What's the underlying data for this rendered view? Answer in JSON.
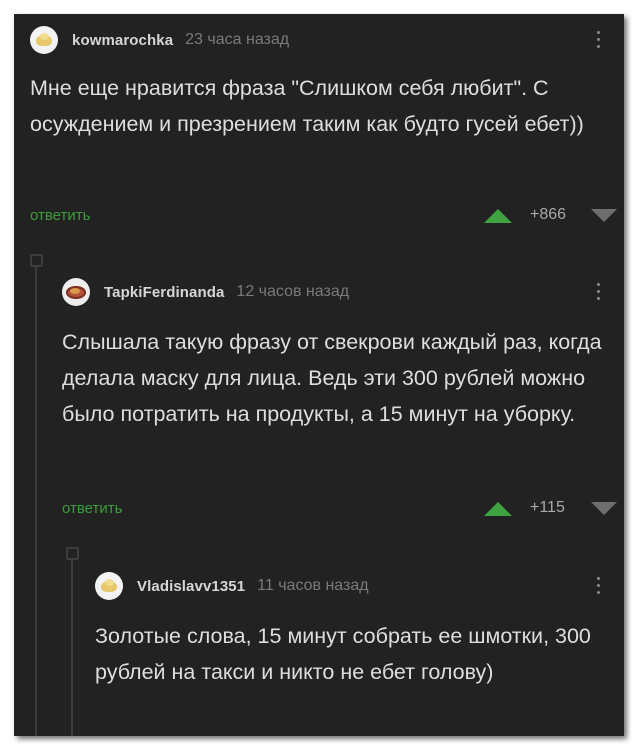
{
  "comments": [
    {
      "username": "kowmarochka",
      "time": "23 часа назад",
      "text": "Мне еще нравится фраза \"Слишком себя любит\". С осуждением и презрением таким как будто гусей ебет))",
      "reply_label": "ответить",
      "rating": "+866"
    },
    {
      "username": "TapkiFerdinanda",
      "time": "12 часов назад",
      "text": "Слышала такую фразу от свекрови каждый раз, когда делала маску для лица. Ведь эти 300 рублей можно было потратить на продукты, а 15 минут на уборку.",
      "reply_label": "ответить",
      "rating": "+115"
    },
    {
      "username": "Vladislavv1351",
      "time": "11 часов назад",
      "text": "Золотые слова, 15 минут собрать ее шмотки, 300 рублей на такси и никто не ебет голову)"
    }
  ],
  "colors": {
    "background": "#222222",
    "upvote": "#3fa33f",
    "reply_link": "#3d9e3d"
  }
}
